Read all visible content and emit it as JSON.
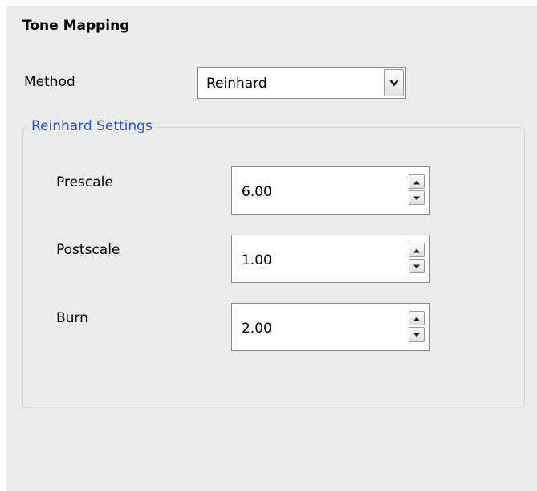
{
  "panel": {
    "title": "Tone Mapping",
    "method": {
      "label": "Method",
      "selected": "Reinhard"
    },
    "group": {
      "title": "Reinhard Settings",
      "fields": [
        {
          "label": "Prescale",
          "value": "6.00"
        },
        {
          "label": "Postscale",
          "value": "1.00"
        },
        {
          "label": "Burn",
          "value": "2.00"
        }
      ]
    }
  },
  "icons": {
    "dropdown": "chevron-down-icon",
    "spin_up": "chevron-up-icon",
    "spin_down": "chevron-down-icon"
  },
  "colors": {
    "panel_background": "#ebebeb",
    "group_title": "#2a55c8"
  }
}
